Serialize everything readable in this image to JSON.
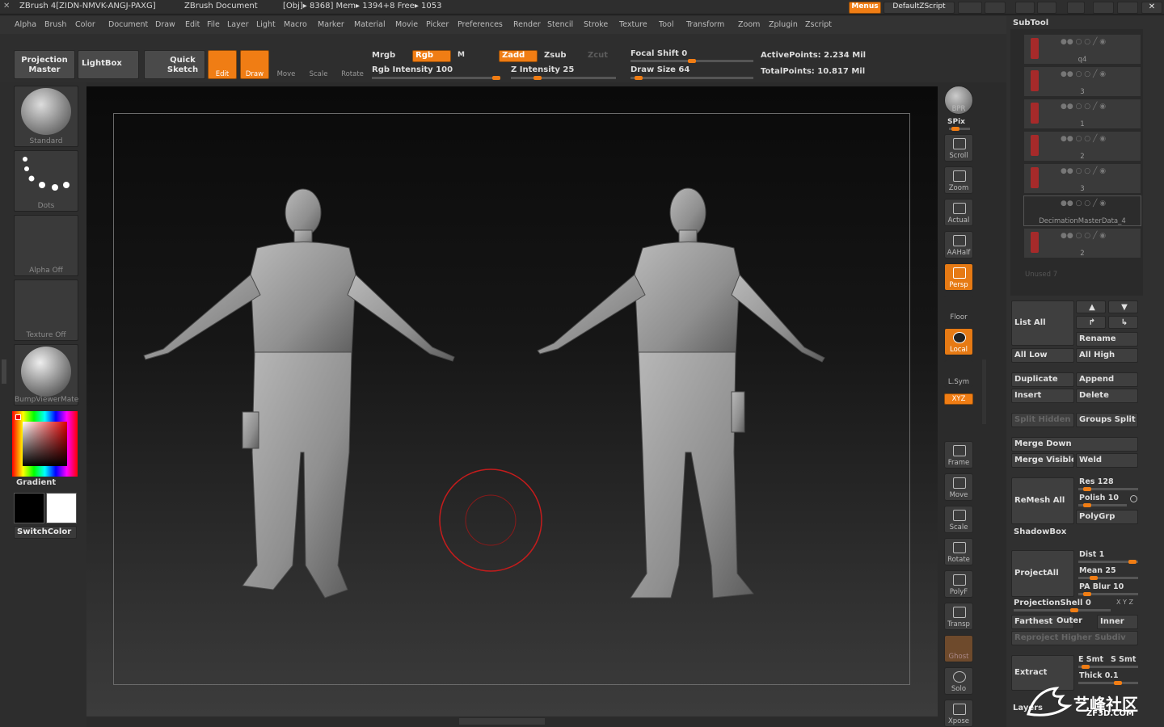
{
  "title": {
    "app": "ZBrush 4[ZIDN-NMVK-ANGJ-PAXG]",
    "doc": "ZBrush Document",
    "stats": "[Obj]▸ 8368] Mem▸ 1394+8 Free▸ 1053",
    "menus_btn": "Menus",
    "script_btn": "DefaultZScript"
  },
  "menu": [
    "Alpha",
    "Brush",
    "Color",
    "Document",
    "Draw",
    "Edit",
    "File",
    "Layer",
    "Light",
    "Macro",
    "Marker",
    "Material",
    "Movie",
    "Picker",
    "Preferences",
    "Render",
    "Stencil",
    "Stroke",
    "Texture",
    "Tool",
    "Transform",
    "Zoom",
    "Zplugin",
    "Zscript"
  ],
  "toolbar": {
    "projection_master": "Projection Master",
    "lightbox": "LightBox",
    "quick_sketch": "Quick Sketch",
    "edit": "Edit",
    "draw": "Draw",
    "move": "Move",
    "scale": "Scale",
    "rotate": "Rotate",
    "mrgb": "Mrgb",
    "rgb": "Rgb",
    "m": "M",
    "zadd": "Zadd",
    "zsub": "Zsub",
    "zcut": "Zcut",
    "rgb_intensity": "Rgb Intensity 100",
    "z_intensity": "Z Intensity 25",
    "focal_shift": "Focal Shift 0",
    "draw_size": "Draw Size 64",
    "active_points": "ActivePoints: 2.234 Mil",
    "total_points": "TotalPoints: 10.817 Mil",
    "rgb_intensity_value": 100,
    "z_intensity_value": 25,
    "focal_shift_value": 0,
    "draw_size_value": 64
  },
  "left": {
    "brush": "Standard",
    "stroke": "Dots",
    "alpha": "Alpha Off",
    "texture": "Texture Off",
    "material": "BumpViewerMate",
    "gradient": "Gradient",
    "switch_color": "SwitchColor"
  },
  "right_shelf": [
    "BPR",
    "SPix",
    "Scroll",
    "Zoom",
    "Actual",
    "AAHalf",
    "Persp",
    "Floor",
    "Local",
    "L.Sym",
    "XYZ",
    "Frame",
    "Move",
    "Scale",
    "Rotate",
    "PolyF",
    "Transp",
    "Ghost",
    "Solo",
    "Xpose"
  ],
  "subtool": {
    "header": "SubTool",
    "rows": [
      "q4",
      "3",
      "1",
      "2",
      "3",
      "DecimationMasterData_4",
      "2"
    ],
    "unused": "Unused 7"
  },
  "panel": {
    "list_all": "List All",
    "rename": "Rename",
    "all_low": "All Low",
    "all_high": "All High",
    "duplicate": "Duplicate",
    "append": "Append",
    "insert": "Insert",
    "delete": "Delete",
    "split_hidden": "Split Hidden",
    "groups_split": "Groups Split",
    "merge_down": "Merge Down",
    "merge_visible": "Merge Visible",
    "weld": "Weld",
    "remesh_all": "ReMesh All",
    "res": "Res 128",
    "polish": "Polish 10",
    "polygrp": "PolyGrp",
    "shadowbox": "ShadowBox",
    "projectall": "ProjectAll",
    "dist": "Dist 1",
    "mean": "Mean 25",
    "pa_blur": "PA Blur 10",
    "projection_shell": "ProjectionShell 0",
    "xyz": "X Y Z",
    "farthest": "Farthest",
    "outer": "Outer",
    "inner": "Inner",
    "reproject": "Reproject Higher Subdiv",
    "extract": "Extract",
    "e_smt": "E Smt",
    "s_smt": "S Smt",
    "thick": "Thick 0.1",
    "layers": "Layers"
  },
  "watermark": {
    "main": "艺峰社区",
    "sub": "ZF3D.COM"
  }
}
